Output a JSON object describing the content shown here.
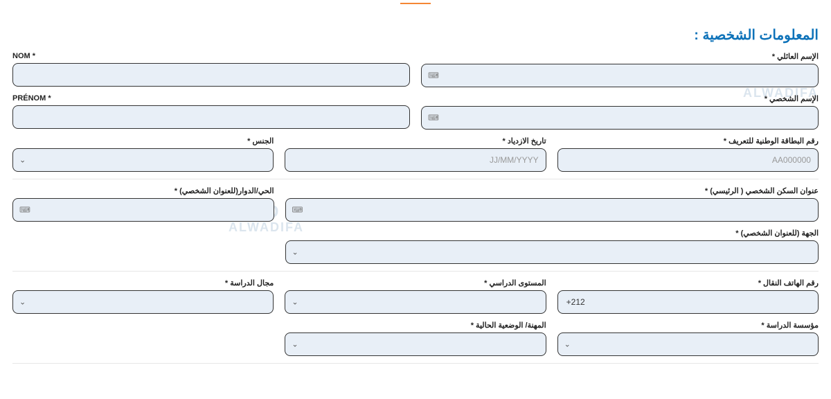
{
  "section_title": "المعلومات الشخصية :",
  "watermark_top": "ADID",
  "watermark_bottom": "ALWADIFA",
  "labels": {
    "nom": "NOM *",
    "family_name": "الإسم العائلي *",
    "prenom": "PRÉNOM *",
    "given_name": "الإسم الشخصي *",
    "gender": "الجنس *",
    "birth_date": "تاريخ الازدياد *",
    "national_id": "رقم البطاقة الوطنية للتعريف *",
    "neighborhood": "الحي/الدوار(للعنوان الشخصي) *",
    "address_main": "عنوان السكن الشخصي ( الرئيسي) *",
    "region": "الجهة (للعنوان الشخصي) *",
    "field_of_study": "مجال الدراسة *",
    "study_level": "المستوى الدراسي *",
    "mobile": "رقم الهاتف النقال *",
    "profession": "المهنة/ الوضعية الحالية *",
    "institution": "مؤسسة الدراسة *"
  },
  "placeholders": {
    "birth_date": "JJ/MM/YYYY",
    "national_id": "AA000000"
  },
  "values": {
    "mobile": "+212"
  }
}
